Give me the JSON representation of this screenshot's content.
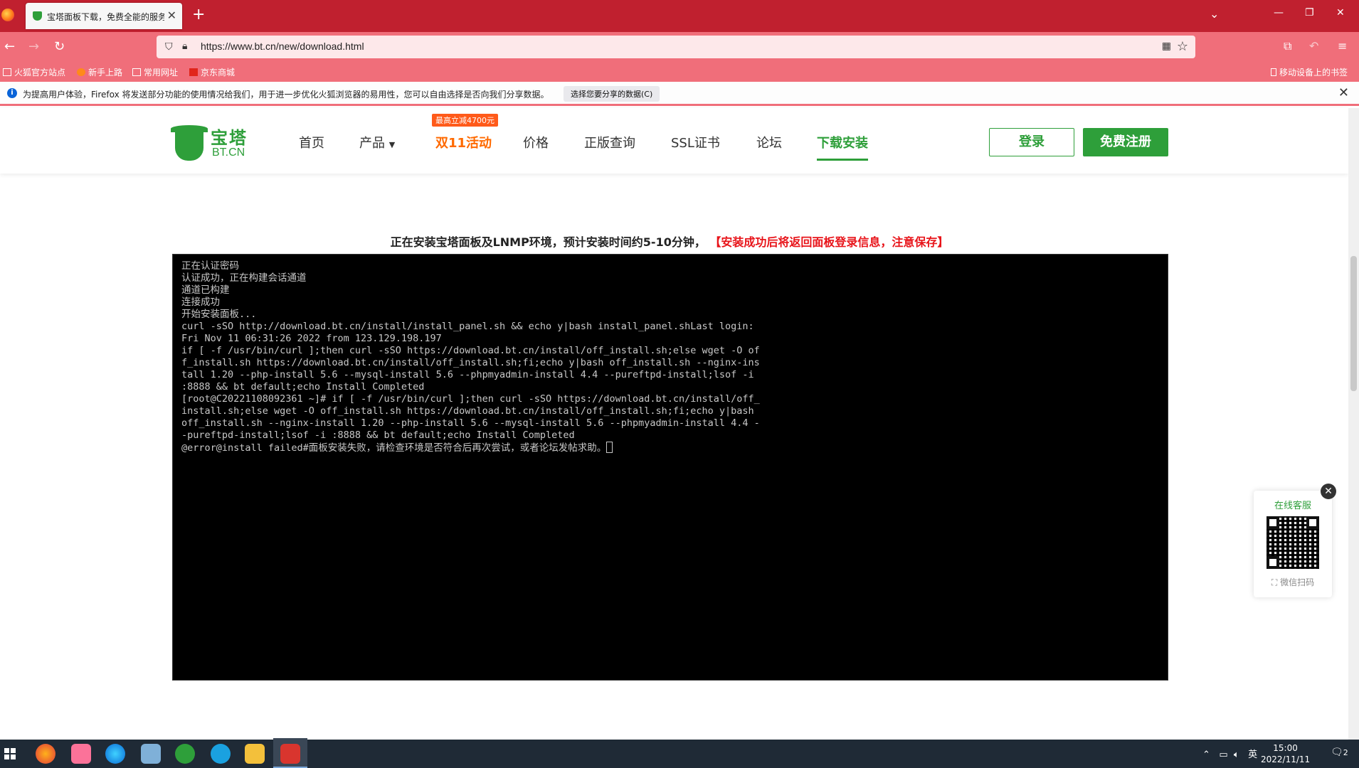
{
  "browser": {
    "tab_title": "宝塔面板下载，免费全能的服务",
    "url": "https://www.bt.cn/new/download.html",
    "bookmarks": [
      "火狐官方站点",
      "新手上路",
      "常用网址",
      "京东商城"
    ],
    "mobile_bookmarks": "移动设备上的书签",
    "notification": {
      "message": "为提高用户体验，Firefox 将发送部分功能的使用情况给我们，用于进一步优化火狐浏览器的易用性，您可以自由选择是否向我们分享数据。",
      "button": "选择您要分享的数据(C)"
    }
  },
  "site": {
    "logo_cn": "宝塔",
    "logo_en": "BT.CN",
    "nav": [
      "首页",
      "产品",
      "双11活动",
      "价格",
      "正版查询",
      "SSL证书",
      "论坛",
      "下载安装"
    ],
    "promo_badge": "最高立减4700元",
    "login": "登录",
    "register": "免费注册"
  },
  "install": {
    "status": "正在安装宝塔面板及LNMP环境，预计安装时间约5-10分钟，",
    "warning": "【安装成功后将返回面板登录信息，注意保存】",
    "terminal_lines": [
      "正在认证密码",
      "认证成功，正在构建会话通道",
      "通道已构建",
      "连接成功",
      "开始安装面板...",
      "curl -sSO http://download.bt.cn/install/install_panel.sh && echo y|bash install_panel.shLast login:",
      "Fri Nov 11 06:31:26 2022 from 123.129.198.197",
      "if [ -f /usr/bin/curl ];then curl -sSO https://download.bt.cn/install/off_install.sh;else wget -O of",
      "f_install.sh https://download.bt.cn/install/off_install.sh;fi;echo y|bash off_install.sh --nginx-ins",
      "tall 1.20 --php-install 5.6 --mysql-install 5.6 --phpmyadmin-install 4.4 --pureftpd-install;lsof -i",
      ":8888 && bt default;echo Install Completed",
      "[root@C20221108092361 ~]# if [ -f /usr/bin/curl ];then curl -sSO https://download.bt.cn/install/off_",
      "install.sh;else wget -O off_install.sh https://download.bt.cn/install/off_install.sh;fi;echo y|bash",
      "off_install.sh --nginx-install 1.20 --php-install 5.6 --mysql-install 5.6 --phpmyadmin-install 4.4 -",
      "-pureftpd-install;lsof -i :8888 && bt default;echo Install Completed",
      "@error@install failed#面板安装失败，请检查环境是否符合后再次尝试，或者论坛发帖求助。"
    ]
  },
  "customer_service": {
    "title": "在线客服",
    "scan": "微信扫码"
  },
  "taskbar": {
    "ime": "英",
    "time": "15:00",
    "date": "2022/11/11",
    "notifications": "2"
  },
  "colors": {
    "brand_green": "#2e9f3a",
    "browser_red": "#c0202f",
    "browser_pink": "#f06e7a",
    "promo_orange": "#ff6a00",
    "warning_red": "#e8141a"
  }
}
